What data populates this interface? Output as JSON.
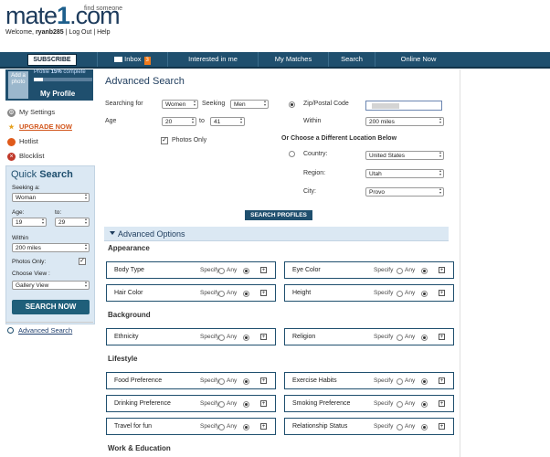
{
  "header": {
    "logo_main": "mate",
    "logo_one": "1",
    "logo_com": ".com",
    "tagline": "find someone",
    "welcome_prefix": "Welcome,",
    "username": "ryanb285",
    "logout": "Log Out",
    "help": "Help",
    "sep": "|"
  },
  "nav": {
    "subscribe": "SUBSCRIBE",
    "inbox": "Inbox",
    "inbox_count": "3",
    "interested": "Interested in me",
    "matches": "My Matches",
    "search": "Search",
    "online": "Online Now"
  },
  "sidebar": {
    "photo": "Add a photo",
    "profile_complete_prefix": "Profile",
    "profile_complete_pct": "15%",
    "profile_complete_suffix": "complete",
    "profile_complete_value": 0.15,
    "my_profile": "My Profile",
    "links": [
      "My Settings",
      "UPGRADE NOW",
      "Hotlist",
      "Blocklist"
    ],
    "quick_search_1": "Quick",
    "quick_search_2": "Search",
    "seeking_label": "Seeking a:",
    "seeking_value": "Woman",
    "age_label": "Age:",
    "to_label": "to:",
    "age_from": "19",
    "age_to": "29",
    "within_label": "Within",
    "within_value": "200 miles",
    "photos_only_label": "Photos Only:",
    "choose_view_label": "Choose View :",
    "view_value": "Gallery View",
    "search_now": "SEARCH NOW",
    "advanced_search": "Advanced Search"
  },
  "main": {
    "title": "Advanced Search",
    "searching_for_label": "Searching for",
    "searching_for_value": "Women",
    "seeking_label": "Seeking",
    "seeking_value": "Men",
    "age_label": "Age",
    "age_from": "20",
    "to_label": "to",
    "age_to": "41",
    "photos_only": "Photos Only",
    "zip_label": "Zip/Postal Code",
    "within_label": "Within",
    "within_value": "200 miles",
    "or_choose": "Or Choose a Different Location Below",
    "country_label": "Country:",
    "country_value": "United States",
    "region_label": "Region:",
    "region_value": "Utah",
    "city_label": "City:",
    "city_value": "Provo",
    "search_profiles": "SEARCH PROFILES",
    "advanced_options": "Advanced Options",
    "specify": "Specify",
    "any": "Any",
    "plus": "+",
    "sections": {
      "appearance": "Appearance",
      "background": "Background",
      "lifestyle": "Lifestyle",
      "work": "Work & Education"
    },
    "options": {
      "body_type": "Body Type",
      "eye_color": "Eye Color",
      "hair_color": "Hair Color",
      "height": "Height",
      "ethnicity": "Ethnicity",
      "religion": "Religion",
      "food_preference": "Food Preference",
      "exercise_habits": "Exercise Habits",
      "drinking_preference": "Drinking Preference",
      "smoking_preference": "Smoking Preference",
      "travel_for_fun": "Travel for fun",
      "relationship_status": "Relationship Status"
    }
  }
}
